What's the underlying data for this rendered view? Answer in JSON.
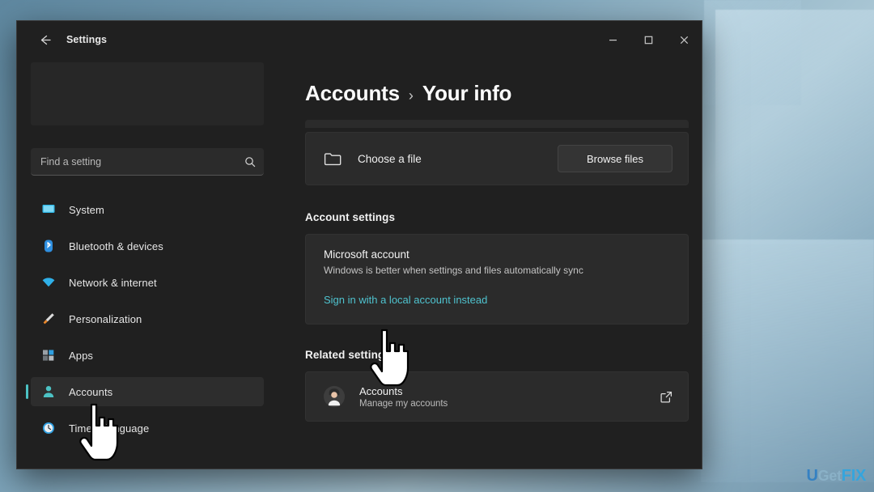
{
  "window": {
    "app_title": "Settings",
    "back_icon": "back-arrow-icon",
    "controls": {
      "minimize": "minimize-icon",
      "maximize": "maximize-icon",
      "close": "close-icon"
    }
  },
  "sidebar": {
    "account_card": {
      "redacted": true
    },
    "search": {
      "placeholder": "Find a setting",
      "value": "",
      "icon": "search-icon"
    },
    "items": [
      {
        "label": "System",
        "icon": "display-monitor-icon",
        "selected": false
      },
      {
        "label": "Bluetooth & devices",
        "icon": "bluetooth-icon",
        "selected": false
      },
      {
        "label": "Network & internet",
        "icon": "wifi-icon",
        "selected": false
      },
      {
        "label": "Personalization",
        "icon": "paintbrush-icon",
        "selected": false
      },
      {
        "label": "Apps",
        "icon": "apps-grid-icon",
        "selected": false
      },
      {
        "label": "Accounts",
        "icon": "person-icon",
        "selected": true
      },
      {
        "label": "Time & language",
        "icon": "clock-icon",
        "selected": false
      }
    ]
  },
  "main": {
    "breadcrumb": {
      "root": "Accounts",
      "separator": "›",
      "leaf": "Your info"
    },
    "choose_file": {
      "icon": "folder-icon",
      "label": "Choose a file",
      "button_label": "Browse files"
    },
    "account_settings": {
      "heading": "Account settings",
      "card": {
        "title": "Microsoft account",
        "description": "Windows is better when settings and files automatically sync",
        "link_label": "Sign in with a local account instead"
      }
    },
    "related_settings": {
      "heading": "Related settings",
      "rows": [
        {
          "icon": "account-avatar-icon",
          "title": "Accounts",
          "subtitle": "Manage my accounts",
          "action_icon": "external-link-icon"
        }
      ]
    }
  },
  "cursors": [
    {
      "name": "pointer-over-local-account-link",
      "type": "hand-pointer"
    },
    {
      "name": "pointer-over-accounts-sidebar-item",
      "type": "hand-pointer"
    }
  ],
  "watermark": {
    "part_u": "U",
    "part_get": "Get",
    "part_fix": "FIX"
  },
  "colors": {
    "window_background": "#202020",
    "card_background": "#2b2b2b",
    "accent_teal": "#4cc2c4",
    "link_teal": "#4fc3cf",
    "selected_nav_background": "#2d2d2d",
    "desktop_blue": "#6d92a8"
  }
}
